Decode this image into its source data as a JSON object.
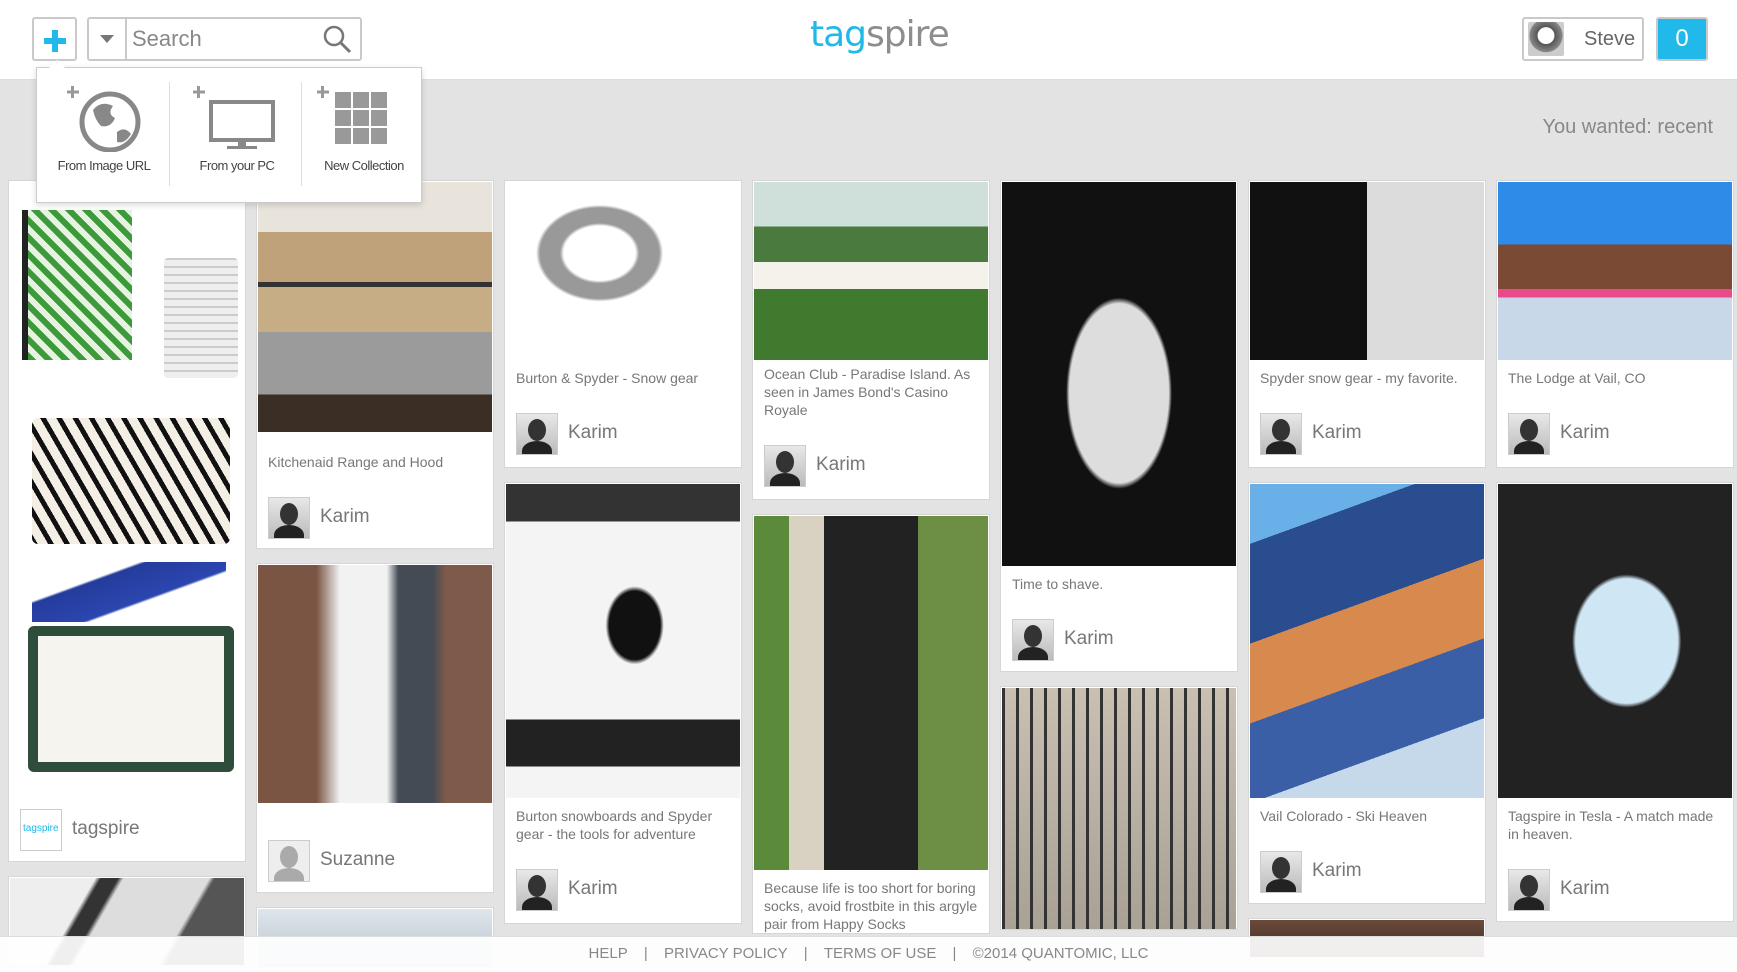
{
  "header": {
    "search_placeholder": "Search",
    "logo_tag": "tag",
    "logo_spire": "spire",
    "user_name": "Steve",
    "notification_count": "0"
  },
  "filter_label": "You wanted: recent",
  "add_menu": {
    "items": [
      {
        "label": "From Image URL",
        "icon": "globe-icon"
      },
      {
        "label": "From your PC",
        "icon": "monitor-icon"
      },
      {
        "label": "New Collection",
        "icon": "grid-icon"
      }
    ]
  },
  "cards": [
    {
      "caption": "",
      "author": "tagspire"
    },
    {
      "caption": "Kitchenaid Range and Hood",
      "author": "Karim"
    },
    {
      "caption": "",
      "author": "Suzanne"
    },
    {
      "caption": "Burton & Spyder - Snow gear",
      "author": "Karim"
    },
    {
      "caption": "Burton snowboards and Spyder gear - the tools for adventure",
      "author": "Karim"
    },
    {
      "caption": "Ocean Club - Paradise Island. As seen in James Bond's Casino Royale",
      "author": "Karim"
    },
    {
      "caption": "Because life is too short for boring socks, avoid frostbite in this argyle pair from Happy Socks",
      "author": ""
    },
    {
      "caption": "Time to shave.",
      "author": "Karim"
    },
    {
      "caption": "Spyder snow gear - my favorite.",
      "author": "Karim"
    },
    {
      "caption": "Vail Colorado - Ski Heaven",
      "author": "Karim"
    },
    {
      "caption": "The Lodge at Vail, CO",
      "author": "Karim"
    },
    {
      "caption": "Tagspire in Tesla - A match made in heaven.",
      "author": "Karim"
    }
  ],
  "brand_mini": "tagspire",
  "footer": {
    "help": "HELP",
    "privacy": "PRIVACY POLICY",
    "terms": "TERMS OF USE",
    "copyright": "©2014 QUANTOMIC, LLC",
    "separator": "|"
  }
}
